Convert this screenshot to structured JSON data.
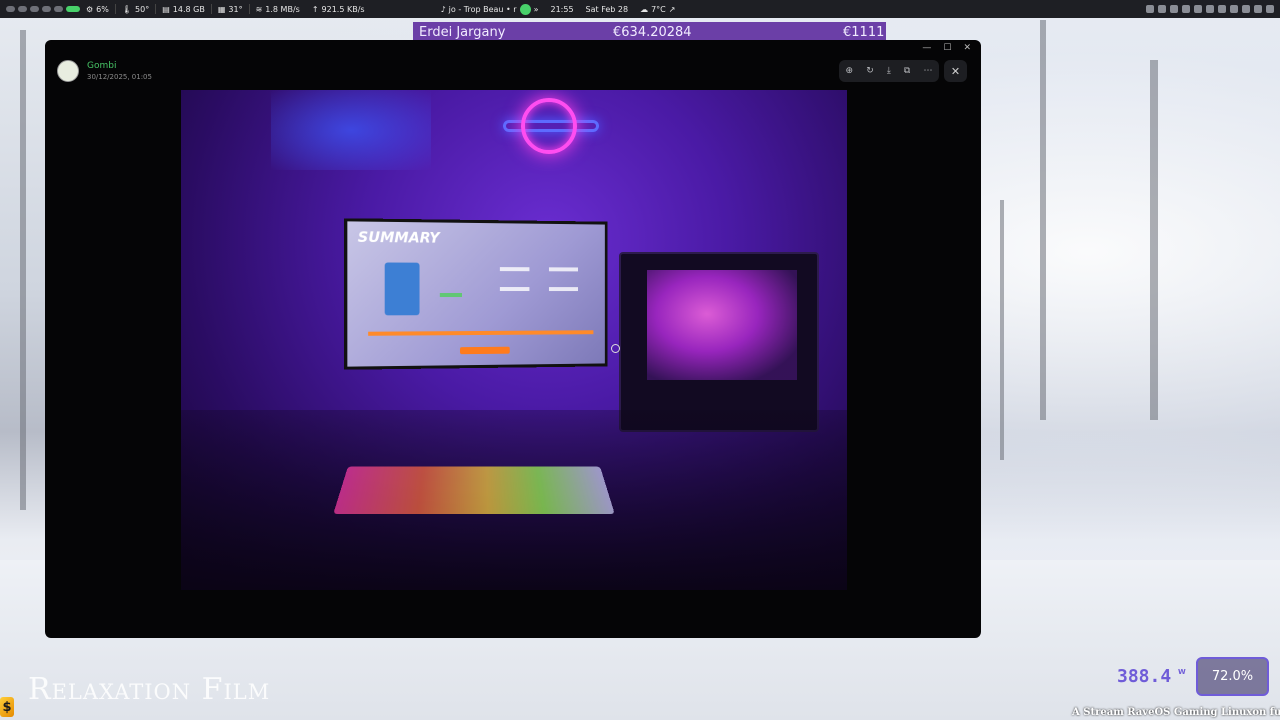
{
  "topbar": {
    "cpu": "6%",
    "temp1": "50°",
    "memory": "14.8 GB",
    "temp2": "31°",
    "download": "1.8 MB/s",
    "upload": "921.5 KB/s",
    "media": "jo - Trop Beau • r",
    "time": "21:55",
    "date": "Sat Feb 28",
    "weather": "7°C",
    "accent": "#48d16a"
  },
  "ticker": {
    "name": "Erdei Jargany",
    "value": "€634.20284",
    "total": "€1111"
  },
  "viewer": {
    "user_name": "Gombi",
    "user_date": "30/12/2025, 01:05",
    "toolbar_icons": [
      "zoom-icon",
      "rotate-icon",
      "download-icon",
      "open-external-icon",
      "more-icon"
    ],
    "close_label": "✕",
    "photo_screen_title": "SUMMARY"
  },
  "overlay": {
    "watermark": "Relaxation Film",
    "dollar": "$",
    "stat_value": "388.4",
    "stat_unit": "W",
    "percent": "72.0%",
    "marquee": "A Stream RaveOS Gaming Linuxon fut"
  }
}
